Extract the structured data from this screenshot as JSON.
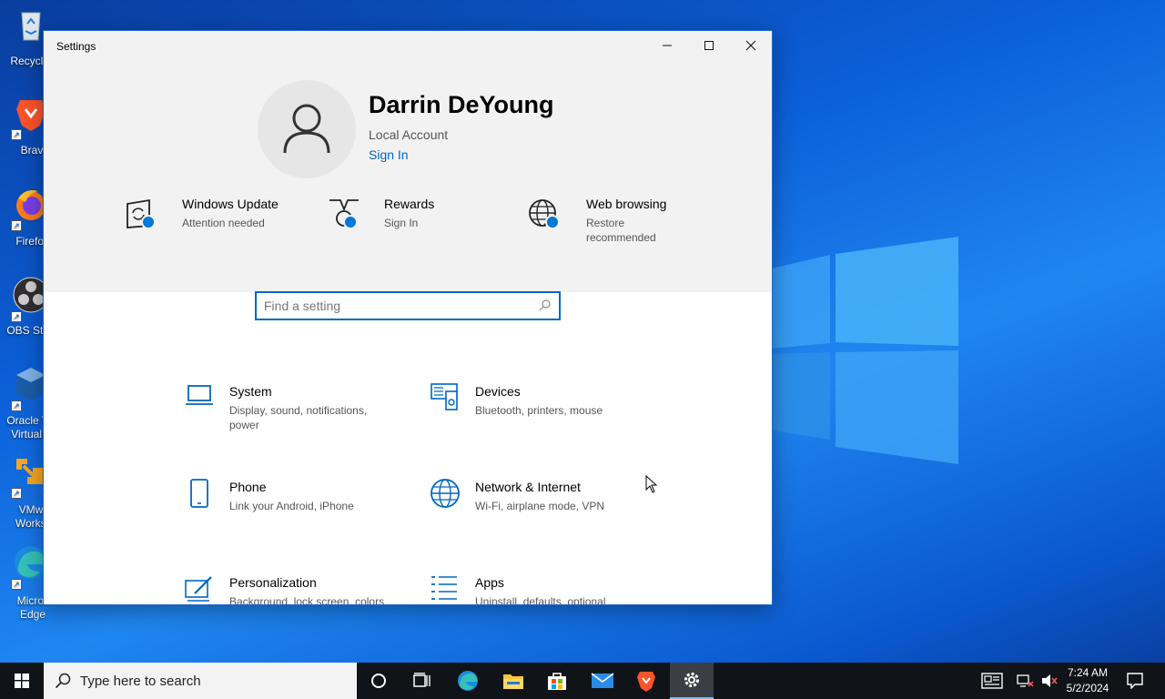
{
  "desktop": {
    "icons": [
      {
        "label": "Recycle",
        "icon": "recycle-bin-icon"
      },
      {
        "label": "Brave",
        "icon": "brave-icon"
      },
      {
        "label": "Firefox",
        "icon": "firefox-icon"
      },
      {
        "label": "OBS Stu",
        "icon": "obs-icon"
      },
      {
        "label": "Oracle V",
        "label2": "VirtualB",
        "icon": "virtualbox-icon"
      },
      {
        "label": "VMwa",
        "label2": "Workst",
        "icon": "vmware-icon"
      },
      {
        "label": "Micros",
        "label2": "Edge",
        "icon": "edge-icon"
      }
    ]
  },
  "window": {
    "title": "Settings",
    "minimize": "─",
    "maximize": "☐",
    "close": "✕"
  },
  "profile": {
    "name": "Darrin DeYoung",
    "account_type": "Local Account",
    "sign_in": "Sign In"
  },
  "status_tiles": [
    {
      "title": "Windows Update",
      "subtitle": "Attention needed",
      "icon": "windows-update-icon"
    },
    {
      "title": "Rewards",
      "subtitle": "Sign In",
      "icon": "rewards-icon"
    },
    {
      "title": "Web browsing",
      "subtitle": "Restore recommended",
      "icon": "web-browsing-icon"
    }
  ],
  "search": {
    "placeholder": "Find a setting"
  },
  "categories": [
    {
      "title": "System",
      "subtitle": "Display, sound, notifications, power",
      "icon": "laptop-icon"
    },
    {
      "title": "Devices",
      "subtitle": "Bluetooth, printers, mouse",
      "icon": "devices-icon"
    },
    {
      "title": "Phone",
      "subtitle": "Link your Android, iPhone",
      "icon": "phone-icon"
    },
    {
      "title": "Network & Internet",
      "subtitle": "Wi-Fi, airplane mode, VPN",
      "icon": "globe-icon"
    },
    {
      "title": "Personalization",
      "subtitle": "Background, lock screen, colors",
      "icon": "personalization-icon"
    },
    {
      "title": "Apps",
      "subtitle": "Uninstall, defaults, optional",
      "icon": "apps-list-icon"
    }
  ],
  "taskbar": {
    "search_placeholder": "Type here to search",
    "time": "7:24 AM",
    "date": "5/2/2024"
  },
  "colors": {
    "accent": "#0078d7",
    "link": "#0067c0"
  }
}
